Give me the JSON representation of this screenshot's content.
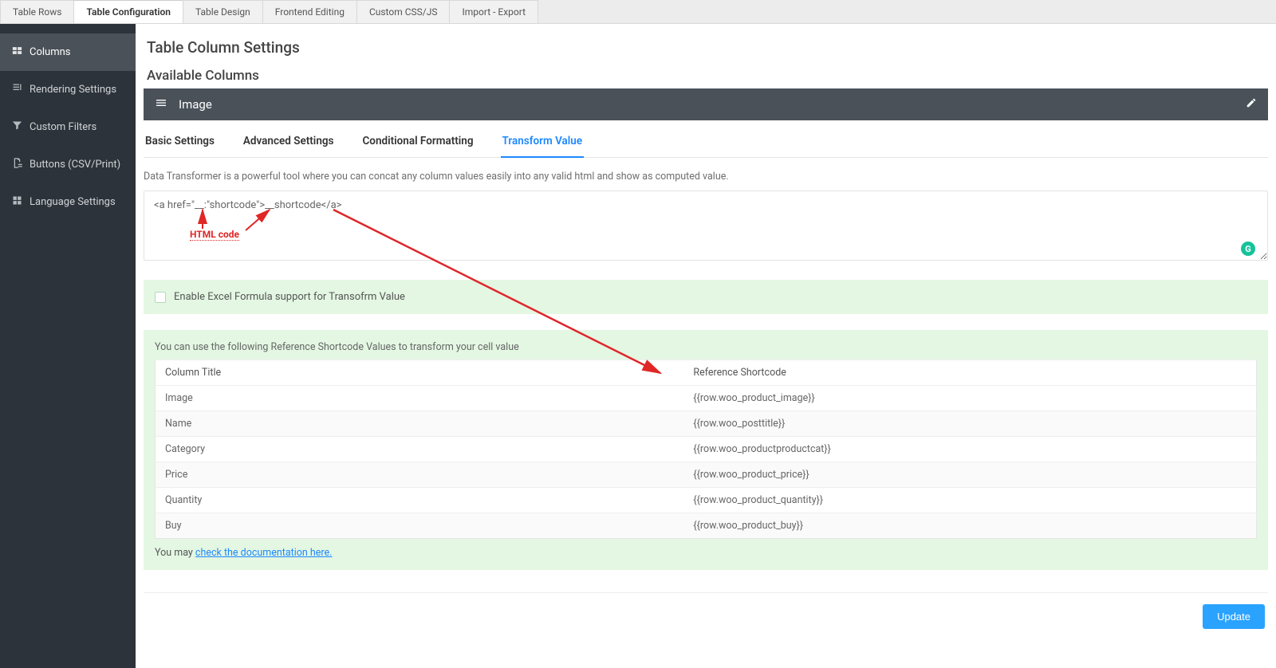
{
  "top_tabs": [
    "Table Rows",
    "Table Configuration",
    "Table Design",
    "Frontend Editing",
    "Custom CSS/JS",
    "Import - Export"
  ],
  "top_tab_active_index": 1,
  "sidebar": {
    "items": [
      {
        "label": "Columns"
      },
      {
        "label": "Rendering Settings"
      },
      {
        "label": "Custom Filters"
      },
      {
        "label": "Buttons (CSV/Print)"
      },
      {
        "label": "Language Settings"
      }
    ],
    "active_index": 0
  },
  "page_title": "Table Column Settings",
  "section_title": "Available Columns",
  "dark_bar_label": "Image",
  "sub_tabs": [
    "Basic Settings",
    "Advanced Settings",
    "Conditional Formatting",
    "Transform Value"
  ],
  "sub_tab_active_index": 3,
  "helper_text": "Data Transformer is a powerful tool where you can concat any column values easily into any valid html and show as computed value.",
  "transform_value": "<a href=\"__:\"shortcode\">__shortcode</a>",
  "annotation_label": "HTML code",
  "checkbox_label": "Enable Excel Formula support for Transofrm Value",
  "ref_intro": "You can use the following Reference Shortcode Values to transform your cell value",
  "ref_table_headers": [
    "Column Title",
    "Reference Shortcode"
  ],
  "ref_rows": [
    {
      "title": "Image",
      "code": "{{row.woo_product_image}}"
    },
    {
      "title": "Name",
      "code": "{{row.woo_posttitle}}"
    },
    {
      "title": "Category",
      "code": "{{row.woo_productproductcat}}"
    },
    {
      "title": "Price",
      "code": "{{row.woo_product_price}}"
    },
    {
      "title": "Quantity",
      "code": "{{row.woo_product_quantity}}"
    },
    {
      "title": "Buy",
      "code": "{{row.woo_product_buy}}"
    }
  ],
  "doc_prefix": "You may ",
  "doc_link_text": "check the documentation here.",
  "update_button": "Update",
  "grammarly_glyph": "G"
}
